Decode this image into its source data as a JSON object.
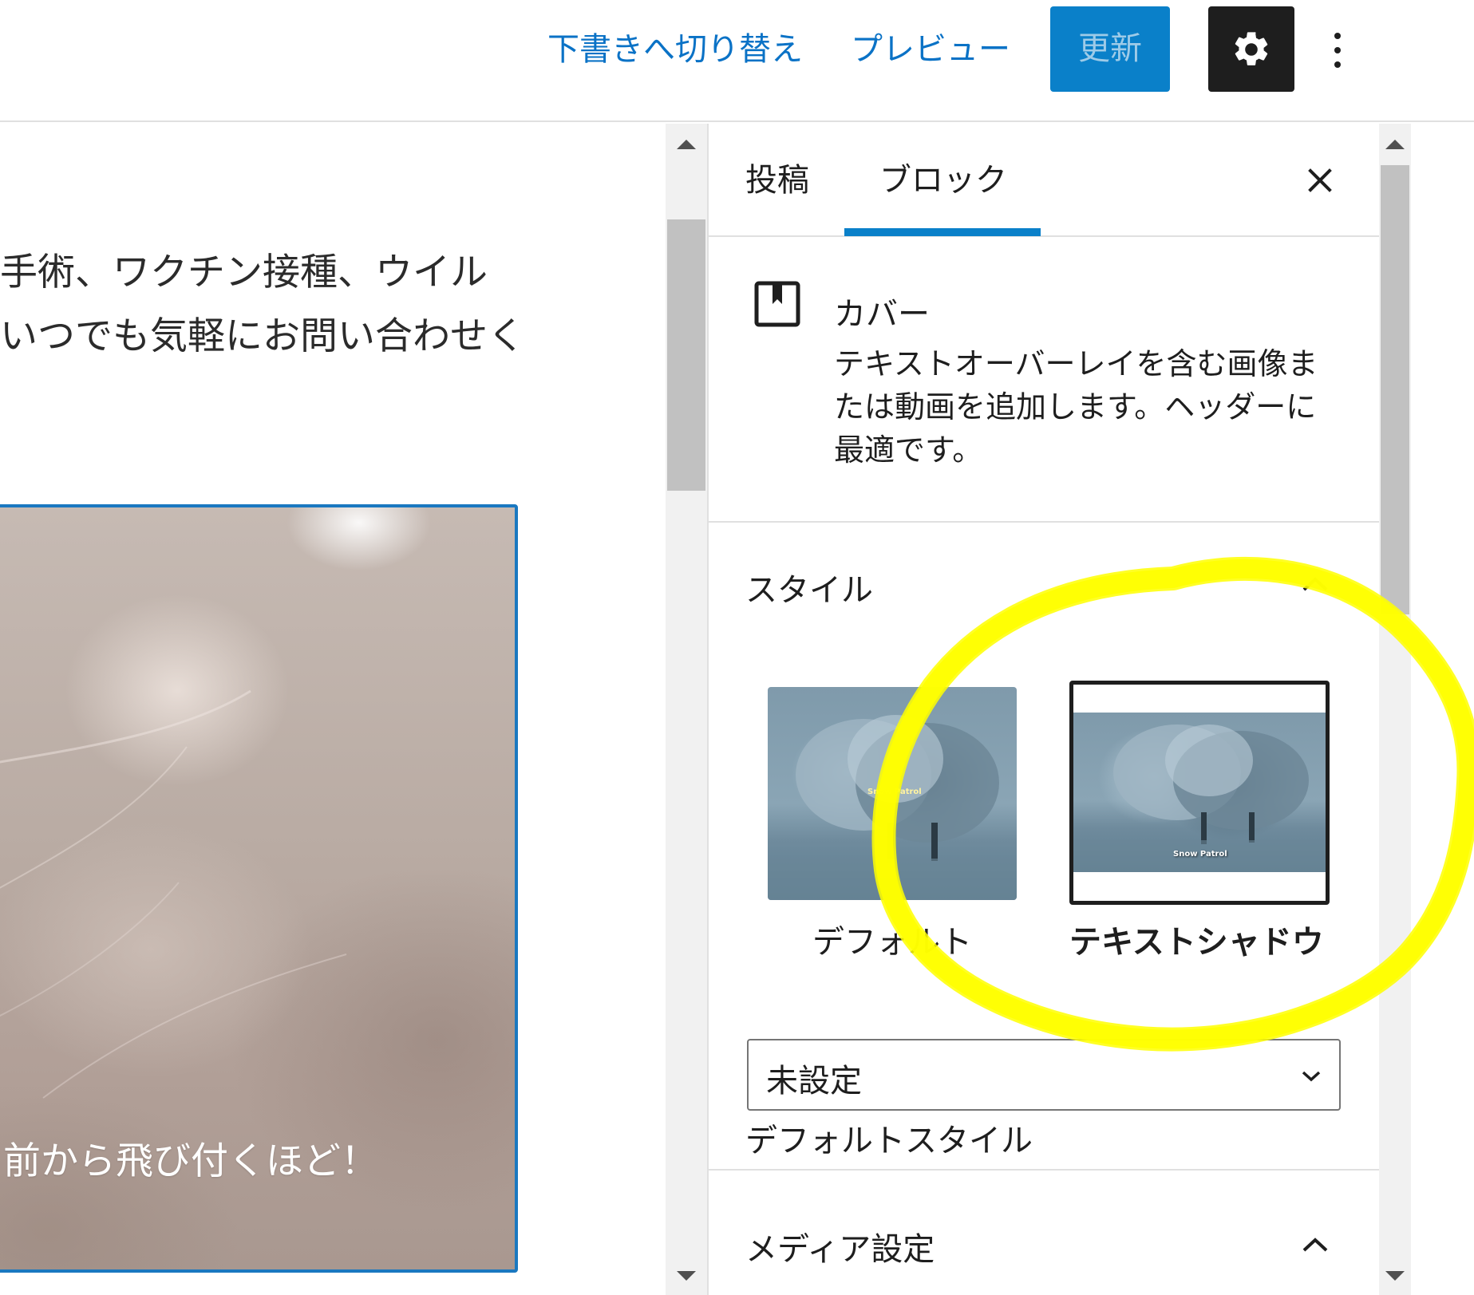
{
  "topbar": {
    "switch_to_draft": "下書きへ切り替え",
    "preview": "プレビュー",
    "update": "更新"
  },
  "canvas": {
    "paragraph_line_1": "手術、ワクチン接種、ウイル",
    "paragraph_line_2": "いつでも気軽にお問い合わせく",
    "cover_text": "前から飛び付くほど！"
  },
  "sidebar": {
    "tabs": [
      {
        "label": "投稿",
        "active": false
      },
      {
        "label": "ブロック",
        "active": true
      }
    ],
    "block_card": {
      "icon": "cover-block-icon",
      "title": "カバー",
      "description": "テキストオーバーレイを含む画像または動画を追加します。ヘッダーに最適です。"
    },
    "styles_panel": {
      "title": "スタイル",
      "options": [
        {
          "label": "デフォルト",
          "caption": "Snow Patrol",
          "selected": false
        },
        {
          "label": "テキストシャドウ",
          "caption": "Snow Patrol",
          "selected": true
        }
      ],
      "default_style_label": "デフォルトスタイル",
      "default_style_value": "未設定"
    },
    "media_panel": {
      "title": "メディア設定"
    }
  },
  "colors": {
    "accent": "#0a80c9",
    "annotation": "#ffff00",
    "dark": "#1e1e1e"
  }
}
